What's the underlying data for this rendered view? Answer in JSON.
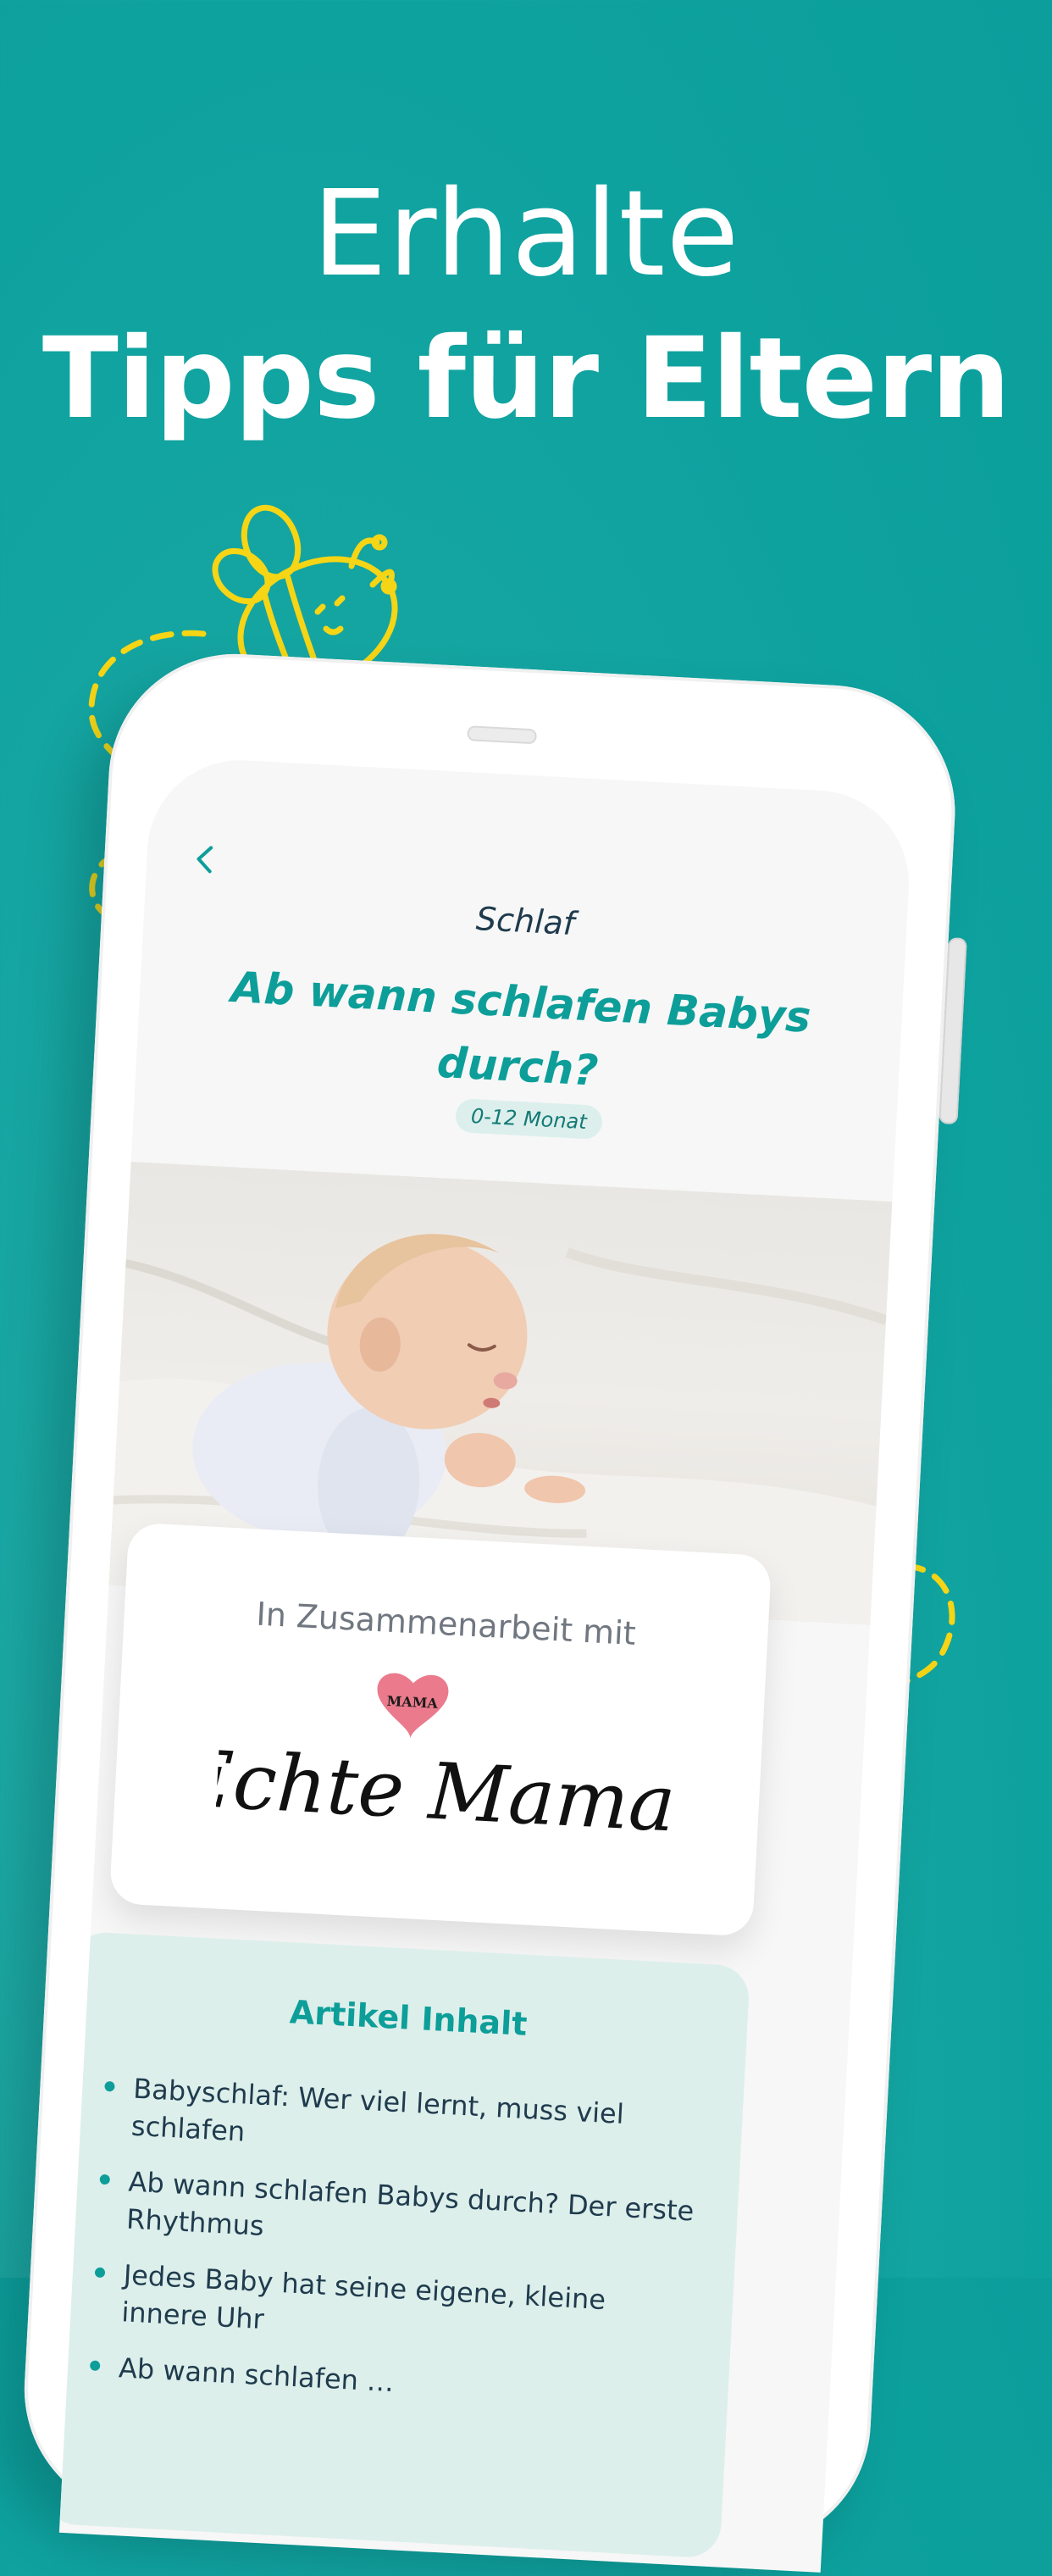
{
  "headline": {
    "line1": "Erhalte",
    "line2": "Tipps für Eltern"
  },
  "colors": {
    "background": "#0ea29f",
    "accent_teal": "#0d9e99",
    "doodle_yellow": "#f5d515",
    "dark_text": "#1f3b4d"
  },
  "icons": {
    "bee": "bee-doodle-icon",
    "back": "chevron-left-icon"
  },
  "article": {
    "category": "Schlaf",
    "title": "Ab wann schlafen Babys durch?",
    "age_badge": "0-12 Monat"
  },
  "partner": {
    "label": "In Zusammenarbeit mit",
    "logo_small": "MAMA",
    "logo_name": "Echte Mamas"
  },
  "toc": {
    "title": "Artikel Inhalt",
    "items": [
      "Babyschlaf: Wer viel lernt, muss viel schlafen",
      "Ab wann schlafen Babys durch? Der erste Rhythmus",
      "Jedes Baby hat seine eigene, kleine innere Uhr",
      "Ab wann schlafen …"
    ]
  }
}
